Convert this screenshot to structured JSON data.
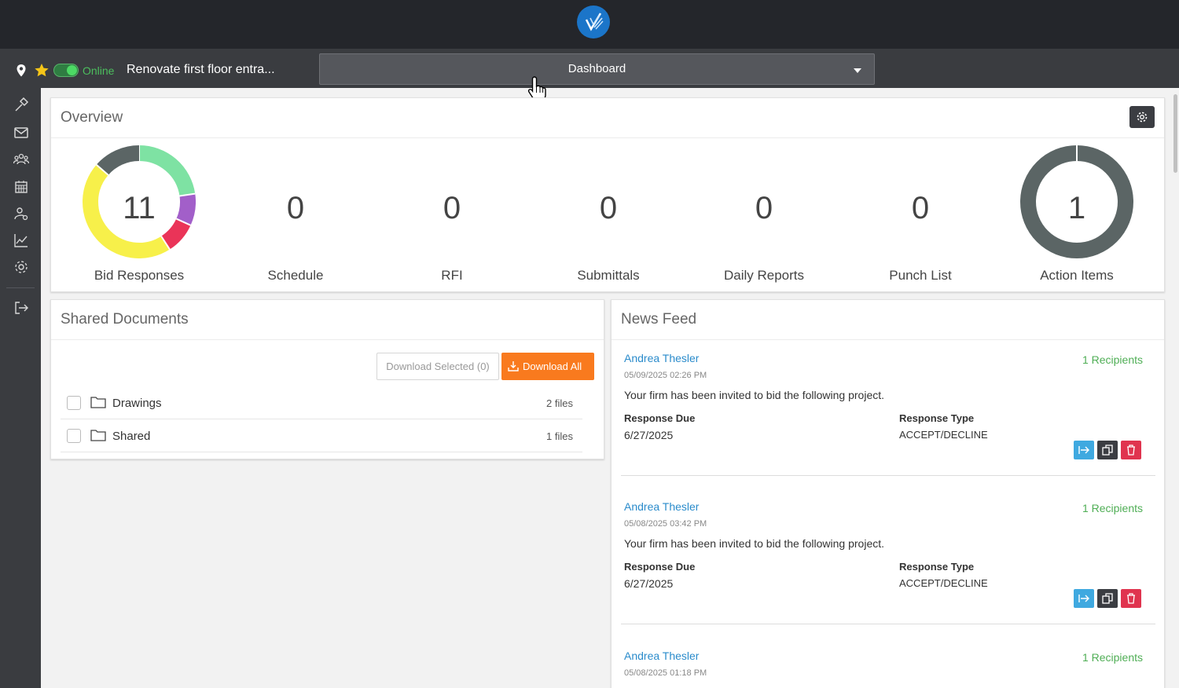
{
  "colors": {
    "topbar": "#24262b",
    "projbar": "#3a3c40",
    "accent_blue": "#2a8bcb",
    "online_green": "#4cbf5e",
    "download_orange": "#f97a1e",
    "delete_red": "#e0344f"
  },
  "projectbar": {
    "status": "Online",
    "project_name": "Renovate first floor entra...",
    "view_selected": "Dashboard"
  },
  "sidebar": {
    "items": [
      {
        "icon": "hammer-icon"
      },
      {
        "icon": "mail-icon"
      },
      {
        "icon": "people-icon"
      },
      {
        "icon": "calendar-icon"
      },
      {
        "icon": "user-settings-icon"
      },
      {
        "icon": "chart-icon"
      },
      {
        "icon": "gear-icon"
      },
      {
        "icon": "logout-icon"
      }
    ]
  },
  "overview": {
    "title": "Overview",
    "stats": [
      {
        "label": "Bid Responses",
        "value": "11"
      },
      {
        "label": "Schedule",
        "value": "0"
      },
      {
        "label": "RFI",
        "value": "0"
      },
      {
        "label": "Submittals",
        "value": "0"
      },
      {
        "label": "Daily Reports",
        "value": "0"
      },
      {
        "label": "Punch List",
        "value": "0"
      },
      {
        "label": "Action Items",
        "value": "1"
      }
    ],
    "bid_donut": [
      {
        "fraction": 0.227,
        "color": "#7ee2a3"
      },
      {
        "fraction": 0.091,
        "color": "#a25fc9"
      },
      {
        "fraction": 0.091,
        "color": "#ea3458"
      },
      {
        "fraction": 0.455,
        "color": "#f7f04a"
      },
      {
        "fraction": 0.136,
        "color": "#5b6565"
      }
    ],
    "action_donut_color": "#5b6565"
  },
  "shared_documents": {
    "title": "Shared Documents",
    "download_selected": "Download Selected (0)",
    "download_all": "Download All",
    "rows": [
      {
        "name": "Drawings",
        "files": "2 files"
      },
      {
        "name": "Shared",
        "files": "1 files"
      }
    ]
  },
  "news_feed": {
    "title": "News Feed",
    "items": [
      {
        "author": "Andrea Thesler",
        "recipients": "1 Recipients",
        "time": "05/09/2025 02:26 PM",
        "message": "Your firm has been invited to bid the following project.",
        "response_due_label": "Response Due",
        "response_due": "6/27/2025",
        "response_type_label": "Response Type",
        "response_type": "ACCEPT/DECLINE"
      },
      {
        "author": "Andrea Thesler",
        "recipients": "1 Recipients",
        "time": "05/08/2025 03:42 PM",
        "message": "Your firm has been invited to bid the following project.",
        "response_due_label": "Response Due",
        "response_due": "6/27/2025",
        "response_type_label": "Response Type",
        "response_type": "ACCEPT/DECLINE"
      },
      {
        "author": "Andrea Thesler",
        "recipients": "1 Recipients",
        "time": "05/08/2025 01:18 PM",
        "message": "",
        "response_due_label": "",
        "response_due": "",
        "response_type_label": "",
        "response_type": ""
      }
    ]
  }
}
